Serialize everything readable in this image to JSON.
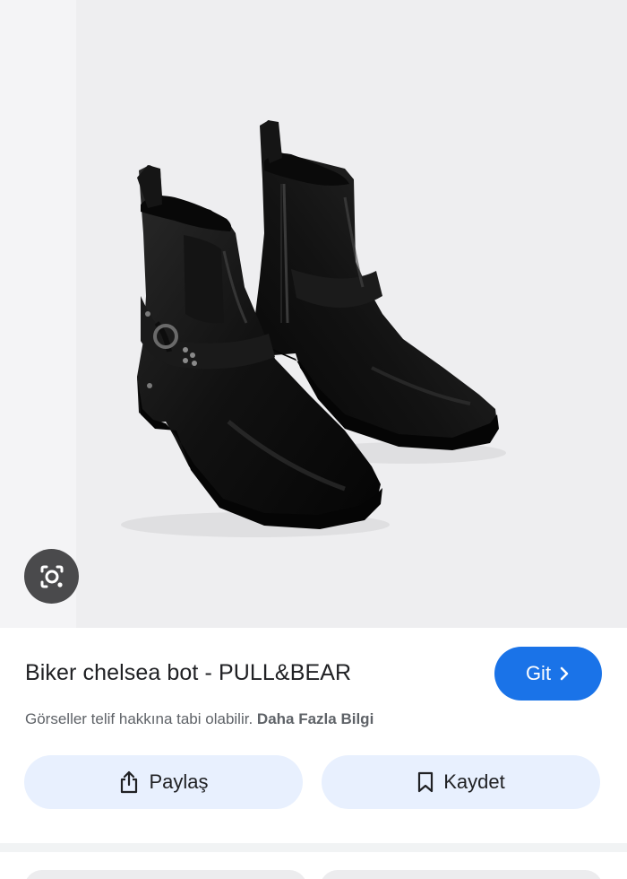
{
  "product": {
    "title": "Biker chelsea bot - PULL&BEAR",
    "image_alt": "black harness chelsea boots"
  },
  "actions": {
    "visit_label": "Git",
    "share_label": "Paylaş",
    "save_label": "Kaydet"
  },
  "notice": {
    "copyright_text": "Görseller telif hakkına tabi olabilir.",
    "more_info_label": "Daha Fazla Bilgi"
  },
  "icons": {
    "lens": "lens-icon",
    "visit": "chevron-right-icon",
    "share": "share-icon",
    "save": "bookmark-icon"
  },
  "colors": {
    "accent": "#1a73e8",
    "action_bg": "#e8f0fe",
    "image_bg": "#eeeef0"
  }
}
